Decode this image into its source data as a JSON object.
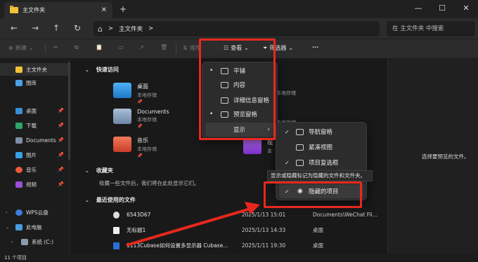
{
  "tab": {
    "title": "主文件夹"
  },
  "window": {
    "newtab": "+",
    "minimize": "—",
    "maximize": "☐",
    "close": "✕"
  },
  "nav": {
    "back": "←",
    "forward": "→",
    "up": "↑",
    "refresh": "↻"
  },
  "address": {
    "crumb": "主文件夹",
    "sep1": ">",
    "sep2": ">"
  },
  "search": {
    "placeholder": "在 主文件夹 中搜索"
  },
  "toolbar": {
    "new_label": "新建",
    "sort_label": "排序",
    "view_label": "查看",
    "filter_label": "筛选器",
    "more_label": "···"
  },
  "sidebar": {
    "items": [
      {
        "label": "主文件夹"
      },
      {
        "label": "图库"
      },
      {
        "label": "桌面"
      },
      {
        "label": "下载"
      },
      {
        "label": "Documents"
      },
      {
        "label": "图片"
      },
      {
        "label": "音乐"
      },
      {
        "label": "视频"
      },
      {
        "label": "WPS云盘"
      },
      {
        "label": "此电脑"
      },
      {
        "label": "系统 (C:)"
      }
    ]
  },
  "content": {
    "quick_access": {
      "title": "快速访问",
      "items": [
        {
          "name": "桌面",
          "sub": "本地存储"
        },
        {
          "name": "Documents",
          "sub": "本地存储"
        },
        {
          "name": "音乐",
          "sub": "本地存储"
        },
        {
          "name": "视",
          "sub": "本"
        }
      ],
      "side_sub": "本地存储"
    },
    "favorites": {
      "title": "收藏夹",
      "empty": "收藏一些文件后，我们将在此处显示它们。"
    },
    "recent": {
      "title": "最近使用的文件",
      "rows": [
        {
          "name": "6543D67",
          "date": "2025/1/13 15:01",
          "location": "Documents\\WeChat Fil..."
        },
        {
          "name": "无标题1",
          "date": "2025/1/13 14:33",
          "location": "桌面"
        },
        {
          "name": "1113Cubase如何设置多显示器 Cubase...",
          "date": "2025/1/11 19:30",
          "location": "桌面"
        }
      ]
    }
  },
  "preview": {
    "text": "选择要预览的文件。"
  },
  "status": {
    "count": "11 个项目"
  },
  "view_menu": {
    "items": [
      {
        "label": "平铺",
        "bullet": "•"
      },
      {
        "label": "内容",
        "bullet": ""
      },
      {
        "label": "详细信息窗格",
        "bullet": ""
      },
      {
        "label": "预览窗格",
        "bullet": "•"
      }
    ],
    "show_label": "显示",
    "show_arrow": "›"
  },
  "show_menu": {
    "items": [
      {
        "label": "导航窗格",
        "check": "✓"
      },
      {
        "label": "紧凑视图",
        "check": ""
      },
      {
        "label": "项目复选框",
        "check": "✓"
      },
      {
        "label": "隐藏的项目",
        "check": "✓"
      }
    ]
  },
  "tooltip": {
    "text": "显示或隐藏标记为隐藏的文件和文件夹。"
  },
  "colors": {
    "accent": "#e8281e",
    "folder": "#f3c03c",
    "bg": "#191919"
  }
}
